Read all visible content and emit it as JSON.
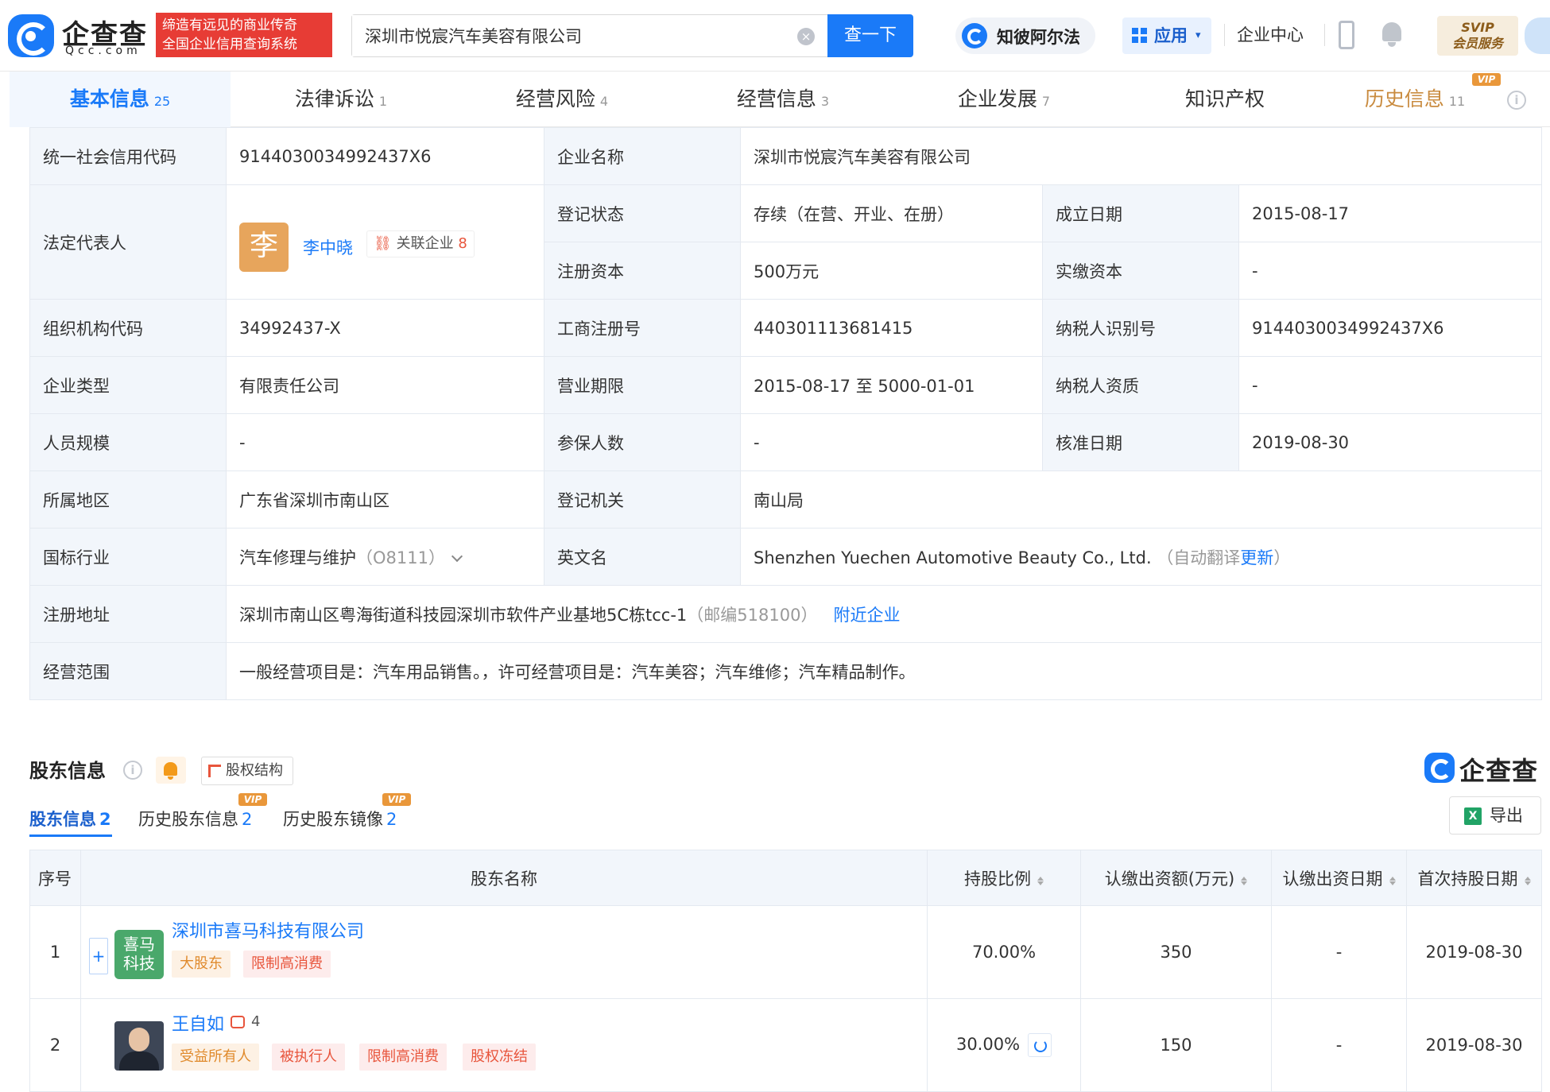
{
  "header": {
    "logo_cn": "企查查",
    "logo_en": "Qcc.com",
    "slogan_line1": "缔造有远见的商业传奇",
    "slogan_line2": "全国企业信用查询系统",
    "search_value": "深圳市悦宸汽车美容有限公司",
    "search_button": "查一下",
    "zhibi": "知彼阿尔法",
    "apps": "应用",
    "enterprise_center": "企业中心",
    "svip_line1": "SVIP",
    "svip_line2": "会员服务"
  },
  "tabs": [
    {
      "label": "基本信息",
      "count": "25"
    },
    {
      "label": "法律诉讼",
      "count": "1"
    },
    {
      "label": "经营风险",
      "count": "4"
    },
    {
      "label": "经营信息",
      "count": "3"
    },
    {
      "label": "企业发展",
      "count": "7"
    },
    {
      "label": "知识产权",
      "count": ""
    },
    {
      "label": "历史信息",
      "count": "11"
    }
  ],
  "vip_label": "VIP",
  "basic": {
    "credit_code_k": "统一社会信用代码",
    "credit_code_v": "9144030034992437X6",
    "name_k": "企业名称",
    "name_v": "深圳市悦宸汽车美容有限公司",
    "legal_rep_k": "法定代表人",
    "legal_rep_avatar": "李",
    "legal_rep_name": "李中晓",
    "related_label": "关联企业",
    "related_count": "8",
    "status_k": "登记状态",
    "status_v": "存续（在营、开业、在册）",
    "found_k": "成立日期",
    "found_v": "2015-08-17",
    "capital_k": "注册资本",
    "capital_v": "500万元",
    "paid_k": "实缴资本",
    "paid_v": "-",
    "org_k": "组织机构代码",
    "org_v": "34992437-X",
    "reg_no_k": "工商注册号",
    "reg_no_v": "440301113681415",
    "tax_k": "纳税人识别号",
    "tax_v": "9144030034992437X6",
    "type_k": "企业类型",
    "type_v": "有限责任公司",
    "term_k": "营业期限",
    "term_v": "2015-08-17 至 5000-01-01",
    "taxq_k": "纳税人资质",
    "taxq_v": "-",
    "staff_k": "人员规模",
    "staff_v": "-",
    "insured_k": "参保人数",
    "insured_v": "-",
    "approve_k": "核准日期",
    "approve_v": "2019-08-30",
    "region_k": "所属地区",
    "region_v": "广东省深圳市南山区",
    "authority_k": "登记机关",
    "authority_v": "南山局",
    "industry_k": "国标行业",
    "industry_v": "汽车修理与维护",
    "industry_code": "（O8111）",
    "en_k": "英文名",
    "en_v": "Shenzhen Yuechen Automotive Beauty Co., Ltd.",
    "en_note_pre": "（自动翻译",
    "en_note_link": "更新",
    "en_note_post": "）",
    "address_k": "注册地址",
    "address_v": "深圳市南山区粤海街道科技园深圳市软件产业基地5C栋tcc-1",
    "address_zip": "（邮编518100）",
    "address_link": "附近企业",
    "scope_k": "经营范围",
    "scope_v": "一般经营项目是：汽车用品销售。，许可经营项目是：汽车美容；汽车维修；汽车精品制作。"
  },
  "shareholders": {
    "title": "股东信息",
    "equity_button": "股权结构",
    "logo_text": "企查查",
    "subtabs": [
      {
        "label": "股东信息",
        "count": "2"
      },
      {
        "label": "历史股东信息",
        "count": "2"
      },
      {
        "label": "历史股东镜像",
        "count": "2"
      }
    ],
    "export_label": "导出",
    "export_icon": "X",
    "headers": [
      "序号",
      "股东名称",
      "持股比例",
      "认缴出资额(万元)",
      "认缴出资日期",
      "首次持股日期"
    ],
    "rows": [
      {
        "index": "1",
        "name": "深圳市喜马科技有限公司",
        "logo_l1": "喜马",
        "logo_l2": "科技",
        "tags": [
          "大股东",
          "限制高消费"
        ],
        "ratio": "70.00%",
        "amount": "350",
        "date": "-",
        "first": "2019-08-30"
      },
      {
        "index": "2",
        "name": "王自如",
        "related": "4",
        "tags": [
          "受益所有人",
          "被执行人",
          "限制高消费",
          "股权冻结"
        ],
        "ratio": "30.00%",
        "amount": "150",
        "date": "-",
        "first": "2019-08-30"
      }
    ]
  }
}
